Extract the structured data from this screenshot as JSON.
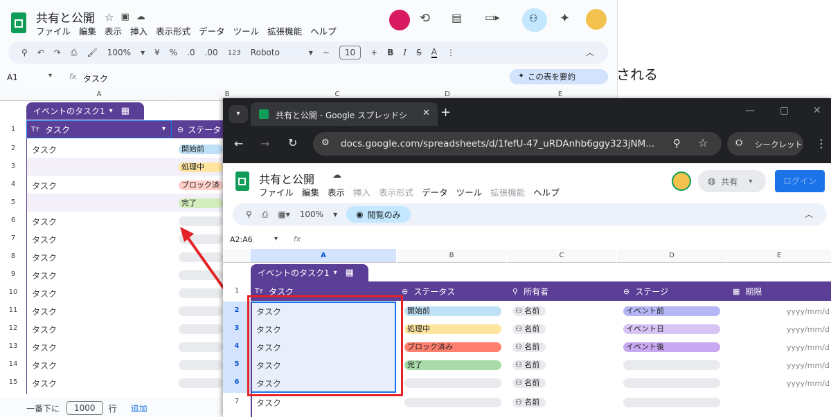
{
  "background_text": "される",
  "back_window": {
    "doc_title": "共有と公開",
    "menu": [
      "ファイル",
      "編集",
      "表示",
      "挿入",
      "表示形式",
      "データ",
      "ツール",
      "拡張機能",
      "ヘルプ"
    ],
    "toolbar": {
      "zoom": "100%",
      "currency": "¥",
      "percent": "%",
      "dec_dec": ".0",
      "inc_dec": ".00",
      "num_fmt": "123",
      "font": "Roboto",
      "font_size": "10",
      "bold": "B",
      "italic": "I",
      "strike": "S",
      "text_color": "A"
    },
    "name_box": "A1",
    "formula": "タスク",
    "summarize_label": "この表を要約",
    "columns": [
      "A",
      "B",
      "C",
      "D",
      "E"
    ],
    "table_name": "イベントのタスク1",
    "header_task": "タスク",
    "header_status": "ステータ",
    "rows": [
      "1",
      "2",
      "3",
      "4",
      "5",
      "6",
      "7",
      "8",
      "9",
      "10",
      "11",
      "12",
      "13",
      "14",
      "15"
    ],
    "task_cell": "タスク",
    "status_chips": [
      {
        "label": "開始前",
        "color": "#bfe1f6"
      },
      {
        "label": "処理中",
        "color": "#ffe5a0"
      },
      {
        "label": "ブロック済",
        "color": "#ffcfc9"
      },
      {
        "label": "完了",
        "color": "#d4edbc"
      }
    ],
    "footer": {
      "label_before": "一番下に",
      "count": "1000",
      "label_after": "行",
      "add": "追加"
    }
  },
  "front_window": {
    "tab_title": "共有と公開 - Google スプレッドシ",
    "url": "docs.google.com/spreadsheets/d/1fefU-47_uRDAnhb6ggy323jNM...",
    "incognito_label": "シークレット",
    "doc_title": "共有と公開",
    "menu": [
      "ファイル",
      "編集",
      "表示",
      "挿入",
      "表示形式",
      "データ",
      "ツール",
      "拡張機能",
      "ヘルプ"
    ],
    "share_label": "共有",
    "login_label": "ログイン",
    "zoom": "100%",
    "view_only_label": "閲覧のみ",
    "name_box": "A2:A6",
    "columns": [
      "A",
      "B",
      "C",
      "D",
      "E"
    ],
    "table_name": "イベントのタスク1",
    "headers": {
      "task": "タスク",
      "status": "ステータス",
      "owner": "所有者",
      "stage": "ステージ",
      "due": "期限"
    },
    "rows": [
      "1",
      "2",
      "3",
      "4",
      "5",
      "6",
      "7"
    ],
    "task_cell": "タスク",
    "owner_chip": "名前",
    "date_placeholder": "yyyy/mm/d",
    "status_chips": [
      {
        "label": "開始前",
        "color": "#bfe1f6"
      },
      {
        "label": "処理中",
        "color": "#ffe5a0"
      },
      {
        "label": "ブロック済み",
        "color": "#ff7f6e"
      },
      {
        "label": "完了",
        "color": "#a8dba8"
      }
    ],
    "stage_chips": [
      {
        "label": "イベント前",
        "color": "#b4b6f5"
      },
      {
        "label": "イベント日",
        "color": "#d6c4f5"
      },
      {
        "label": "イベント後",
        "color": "#c8a8f0"
      }
    ]
  },
  "colors": {
    "annotation_red": "#e42326",
    "table_purple": "#5b3e96",
    "sheets_green": "#0f9d58",
    "login_blue": "#1a73e8"
  }
}
